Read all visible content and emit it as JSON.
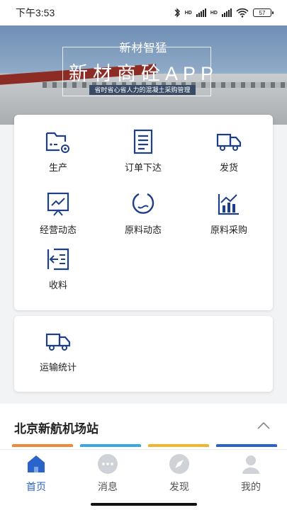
{
  "status": {
    "time": "下午3:53",
    "battery": "57",
    "hd1": "HD",
    "hd2": "HD"
  },
  "banner": {
    "subtitle": "新材智猛",
    "title": "新材商砼APP",
    "tagline": "省时省心省人力的混凝土采购管理"
  },
  "menu": {
    "items": [
      {
        "label": "生产",
        "icon": "production-folder-icon"
      },
      {
        "label": "订单下达",
        "icon": "order-list-icon"
      },
      {
        "label": "发货",
        "icon": "delivery-truck-icon"
      },
      {
        "label": "经营动态",
        "icon": "business-chart-icon"
      },
      {
        "label": "原料动态",
        "icon": "material-drop-icon"
      },
      {
        "label": "原料采购",
        "icon": "purchase-chart-icon"
      },
      {
        "label": "收料",
        "icon": "receive-icon"
      }
    ],
    "secondary": [
      {
        "label": "运输统计",
        "icon": "transport-truck-icon"
      }
    ]
  },
  "site": {
    "name": "北京新航机场站"
  },
  "tabs": [
    {
      "label": "首页",
      "icon": "home-icon",
      "active": true
    },
    {
      "label": "消息",
      "icon": "message-icon",
      "active": false
    },
    {
      "label": "发现",
      "icon": "compass-icon",
      "active": false
    },
    {
      "label": "我的",
      "icon": "user-icon",
      "active": false
    }
  ],
  "colors": {
    "accent": "#2a63c9",
    "icon": "#1d3f8a",
    "stripes": [
      "#f08a3b",
      "#39a6e8",
      "#f2b52e",
      "#2a63c9"
    ]
  }
}
